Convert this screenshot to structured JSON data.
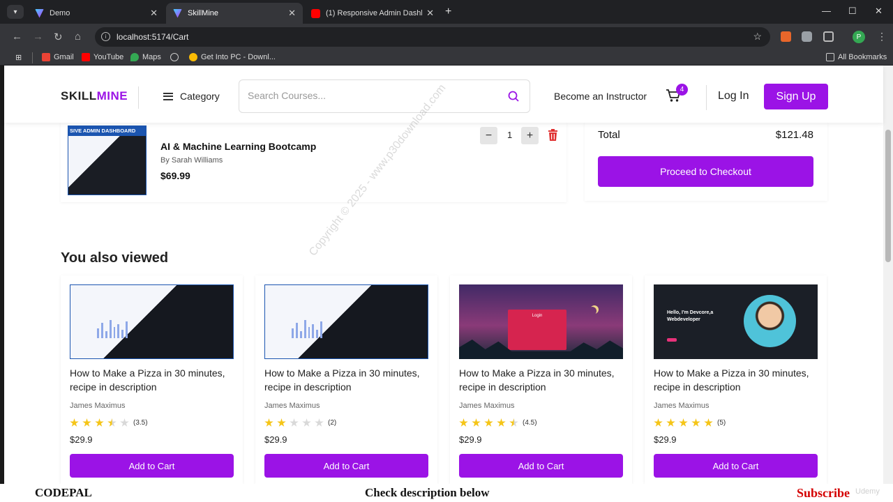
{
  "browser": {
    "tabs": [
      {
        "title": "Demo",
        "active": false,
        "icon": "vite-icon"
      },
      {
        "title": "SkillMine",
        "active": true,
        "icon": "vite-icon"
      },
      {
        "title": "(1) Responsive Admin Dashboa",
        "active": false,
        "icon": "youtube-icon"
      }
    ],
    "url": "localhost:5174/Cart",
    "bookmarks": [
      {
        "label": "Gmail",
        "icon": "gmail-icon"
      },
      {
        "label": "YouTube",
        "icon": "youtube-icon"
      },
      {
        "label": "Maps",
        "icon": "maps-icon"
      },
      {
        "label": "",
        "icon": "globe-icon"
      },
      {
        "label": "Get Into PC - Downl...",
        "icon": "g-icon"
      }
    ],
    "all_bookmarks": "All Bookmarks",
    "profile_initial": "P"
  },
  "header": {
    "logo_part1": "SKILL",
    "logo_part2": "MINE",
    "category": "Category",
    "search_placeholder": "Search Courses...",
    "become_instructor": "Become an Instructor",
    "cart_count": "4",
    "login": "Log In",
    "signup": "Sign Up"
  },
  "cart_item": {
    "thumb_banner": "SIVE ADMIN DASHBOARD",
    "title": "AI & Machine Learning Bootcamp",
    "author": "By Sarah Williams",
    "price": "$69.99",
    "quantity": "1",
    "minus": "−",
    "plus": "+"
  },
  "summary": {
    "total_label": "Total",
    "total_value": "$121.48",
    "checkout": "Proceed to Checkout"
  },
  "section_title": "You also viewed",
  "courses": [
    {
      "title": "How to Make a Pizza in 30 minutes, recipe in description",
      "author": "James Maximus",
      "rating": 3.5,
      "rating_text": "(3.5)",
      "price": "$29.9",
      "button": "Add to Cart",
      "thumb": "dashboard"
    },
    {
      "title": "How to Make a Pizza in 30 minutes, recipe in description",
      "author": "James Maximus",
      "rating": 2,
      "rating_text": "(2)",
      "price": "$29.9",
      "button": "Add to Cart",
      "thumb": "dashboard"
    },
    {
      "title": "How to Make a Pizza in 30 minutes, recipe in description",
      "author": "James Maximus",
      "rating": 4.5,
      "rating_text": "(4.5)",
      "price": "$29.9",
      "button": "Add to Cart",
      "thumb": "login",
      "thumb_text": "Login"
    },
    {
      "title": "How to Make a Pizza in 30 minutes, recipe in description",
      "author": "James Maximus",
      "rating": 5,
      "rating_text": "(5)",
      "price": "$29.9",
      "button": "Add to Cart",
      "thumb": "developer",
      "thumb_text": "Hello, I'm Devcore,a Webdeveloper"
    }
  ],
  "watermark": "Copyright © 2025 - www.p30download.com",
  "overlay": {
    "left": "CODEPAL",
    "center": "Check description below",
    "right": "Subscribe",
    "brand": "Udemy"
  },
  "colors": {
    "accent": "#9b13e6",
    "star": "#f5c518",
    "star_empty": "#d9d9d9",
    "trash": "#e03131"
  }
}
